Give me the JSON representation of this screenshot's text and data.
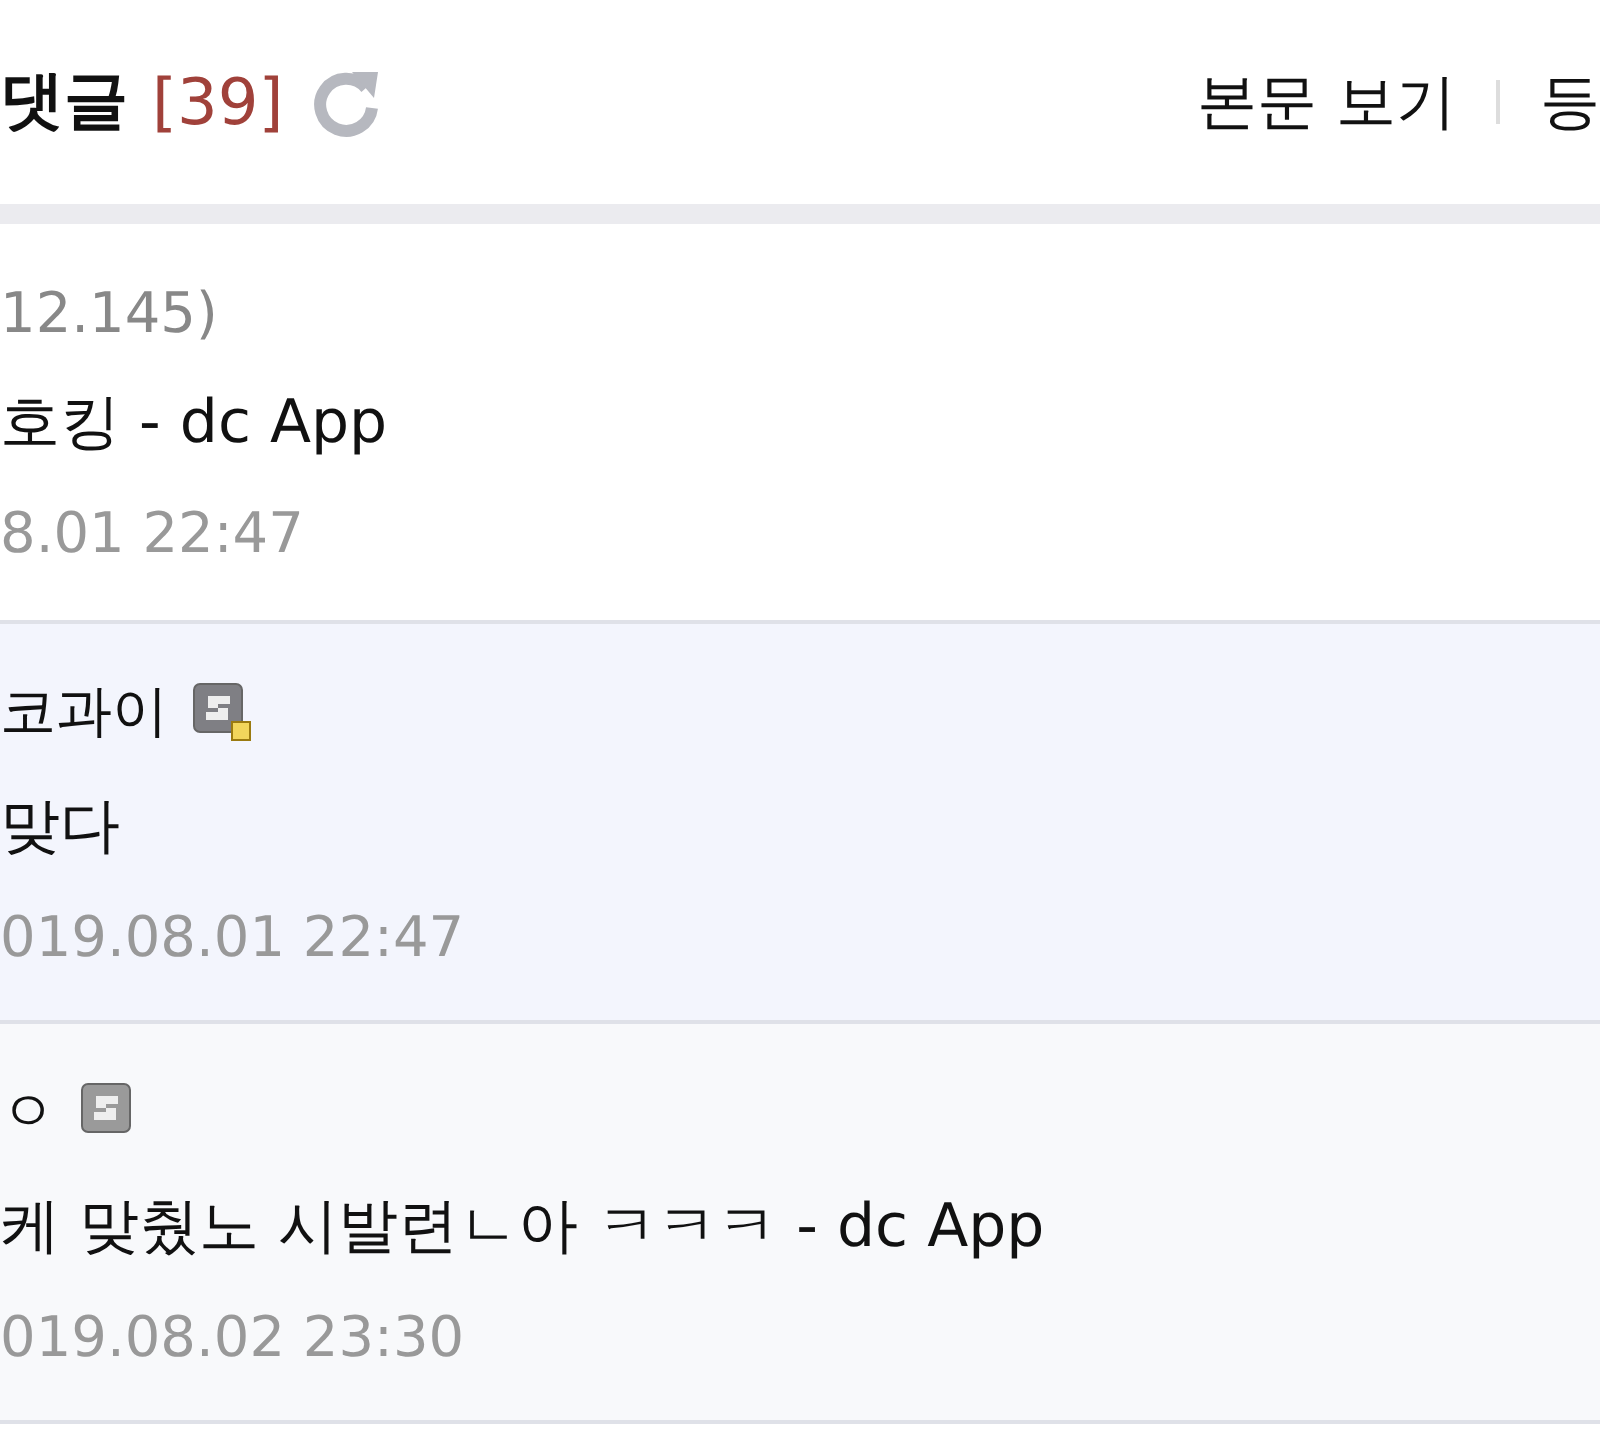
{
  "header": {
    "title": "댓글",
    "count": "[39]",
    "links": [
      "본문 보기",
      "등"
    ]
  },
  "comments": [
    {
      "kind": "plain",
      "writer": "12.145)",
      "has_icon": false,
      "body": "호킹 - dc App",
      "date": "8.01 22:47"
    },
    {
      "kind": "highlight",
      "writer": "코과이",
      "has_icon": true,
      "fixed_member": true,
      "body": "맞다",
      "date": "019.08.01 22:47"
    },
    {
      "kind": "muted",
      "writer": "ㅇ",
      "has_icon": true,
      "fixed_member": false,
      "body": "케 맞췄노 시발련ㄴ아 ㅋㅋㅋ - dc App",
      "date": "019.08.02 23:30"
    }
  ]
}
